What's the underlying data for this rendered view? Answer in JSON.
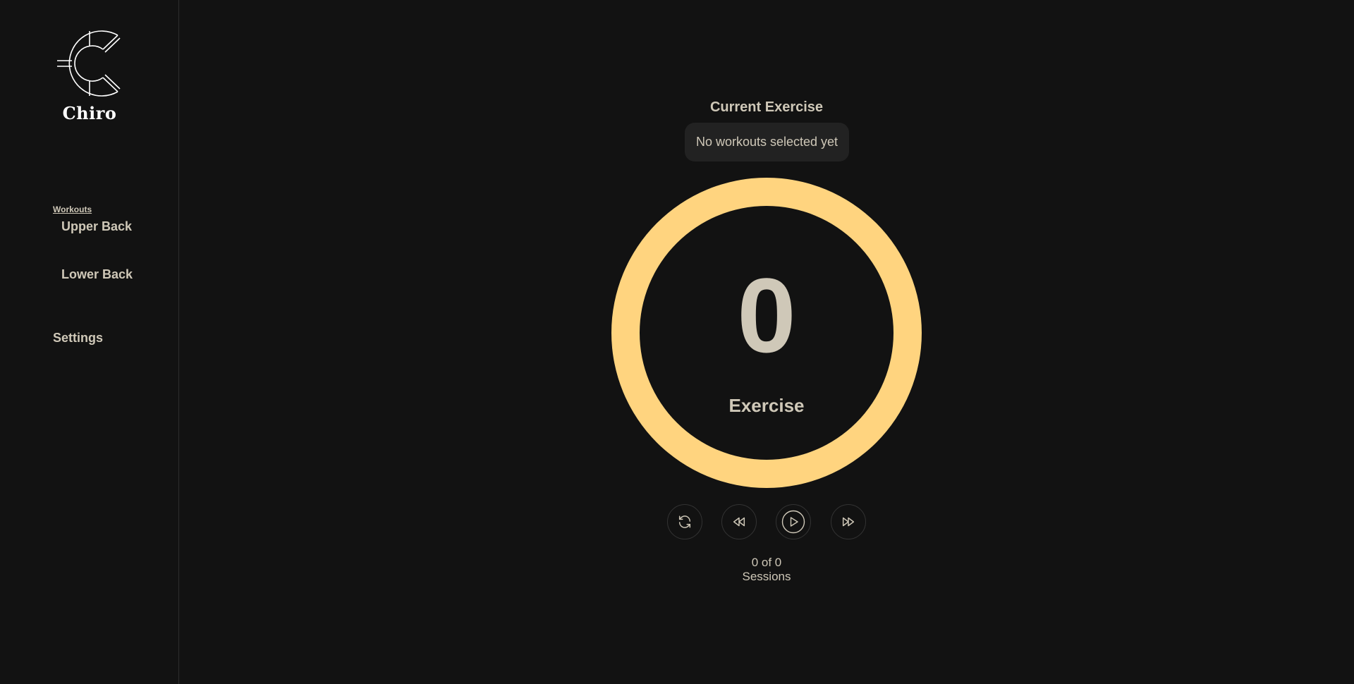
{
  "brand": {
    "name": "Chiro",
    "logo_icon": "chiro-c-logo"
  },
  "sidebar": {
    "section_label": "Workouts",
    "items": [
      {
        "label": "Upper Back"
      },
      {
        "label": "Lower Back"
      }
    ],
    "settings_label": "Settings"
  },
  "exercise": {
    "title": "Current Exercise",
    "status": "No workouts selected yet",
    "count": "0",
    "count_label": "Exercise",
    "ring_color": "#ffd47f",
    "progress": 1.0
  },
  "controls": [
    {
      "name": "reset",
      "icon": "refresh-icon"
    },
    {
      "name": "previous",
      "icon": "rewind-icon"
    },
    {
      "name": "play",
      "icon": "play-icon"
    },
    {
      "name": "next",
      "icon": "fast-forward-icon"
    }
  ],
  "sessions": {
    "progress_text": "0 of 0",
    "label": "Sessions"
  },
  "colors": {
    "background": "#121212",
    "text": "#cfc8b8",
    "accent": "#ffd47f"
  }
}
